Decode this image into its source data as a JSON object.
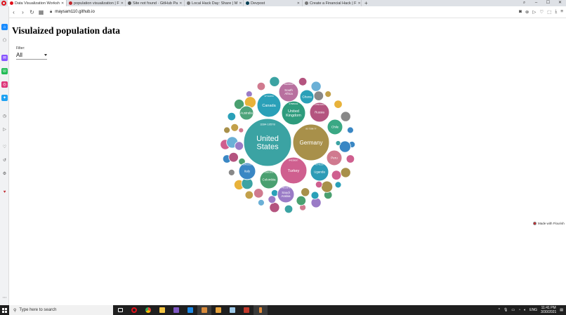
{
  "browser": {
    "tabs": [
      {
        "title": "Data Visualization Worksh",
        "active": true,
        "color": "#e0101a"
      },
      {
        "title": "population visualization | F",
        "active": false,
        "color": "#c0282d"
      },
      {
        "title": "Site not found · GitHub Pa",
        "active": false,
        "color": "#555555"
      },
      {
        "title": "Local Hack Day: Share | M",
        "active": false,
        "color": "#777777"
      },
      {
        "title": "Devpost",
        "active": false,
        "color": "#003e54"
      },
      {
        "title": "Create a Financial Hack | F",
        "active": false,
        "color": "#777777"
      }
    ],
    "url": "maysam110.github.io"
  },
  "page": {
    "title": "Visulaized population data",
    "filter_label": "Filter:",
    "filter_value": "All",
    "made_with": "Made with Flourish",
    "chart_note": "Bubble labels printed on the chart"
  },
  "chart_data": {
    "type": "bubble",
    "labels": [
      {
        "name": "United States",
        "sub": "3284·10578",
        "color": "#3ba3a3"
      },
      {
        "name": "Germany",
        "sub": "83 7398·77",
        "color": "#a8904a"
      },
      {
        "name": "Turkey",
        "sub": "84339067",
        "color": "#cf5f8f"
      },
      {
        "name": "United Kingdom",
        "sub": "67886011",
        "color": "#2e9c7d"
      },
      {
        "name": "Russia",
        "sub": "145934462",
        "color": "#b4547f"
      },
      {
        "name": "Canada",
        "sub": "37742154",
        "color": "#2aa0b8"
      },
      {
        "name": "Italy",
        "sub": "60461826",
        "color": "#3a87c4"
      },
      {
        "name": "Colombia",
        "sub": "50882891",
        "color": "#4aa070"
      },
      {
        "name": "Uganda",
        "sub": "45741007",
        "color": "#2d9bb6"
      },
      {
        "name": "South Africa",
        "sub": "59308690",
        "color": "#b8709f"
      },
      {
        "name": "Saudi Arabia",
        "sub": "34813871",
        "color": "#9a7bc6"
      },
      {
        "name": "Peru",
        "sub": "",
        "color": "#d07a8f"
      },
      {
        "name": "Chile",
        "sub": "",
        "color": "#3aa884"
      },
      {
        "name": "Ghana",
        "sub": "",
        "color": "#2aa0b8"
      },
      {
        "name": "Australia",
        "sub": "",
        "color": "#4ea37a"
      }
    ]
  },
  "taskbar": {
    "search_placeholder": "Type here to search",
    "lang": "ENG",
    "time": "11:41 PM",
    "date": "3/30/2021"
  }
}
